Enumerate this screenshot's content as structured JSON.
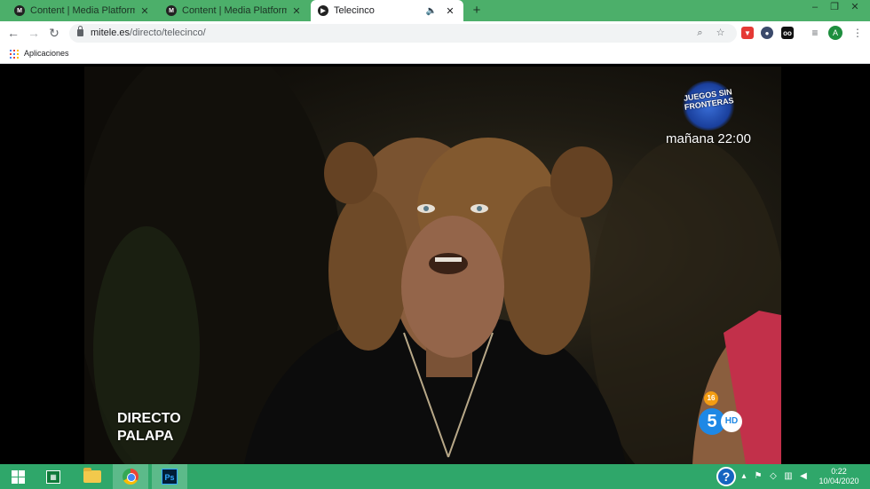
{
  "browser": {
    "tabs": [
      {
        "favicon": "M",
        "title": "Content | Media Platform",
        "active": false,
        "audio": false
      },
      {
        "favicon": "M",
        "title": "Content | Media Platform",
        "active": false,
        "audio": false
      },
      {
        "favicon": "▶",
        "title": "Telecinco",
        "active": true,
        "audio": true
      }
    ],
    "url_host": "mitele.es",
    "url_path": "/directo/telecinco/",
    "bookmarks_label": "Aplicaciones",
    "avatar_initial": "A"
  },
  "video": {
    "promo_logo_text": "JUEGOS SIN FRONTERAS",
    "promo_time": "mañana 22:00",
    "live_line1": "DIRECTO",
    "live_line2": "PALAPA",
    "age_rating": "16",
    "channel_number": "5",
    "channel_hd": "HD"
  },
  "taskbar": {
    "time": "0:22",
    "date": "10/04/2020"
  },
  "icons": {
    "back": "back-arrow-icon",
    "forward": "forward-arrow-icon",
    "reload": "reload-icon",
    "zoom": "search-icon",
    "star": "star-icon",
    "menu": "kebab-menu-icon"
  },
  "colors": {
    "tabstrip": "#4caf6a",
    "taskbar": "#2fa76a",
    "channel_blue": "#1e88e5"
  }
}
